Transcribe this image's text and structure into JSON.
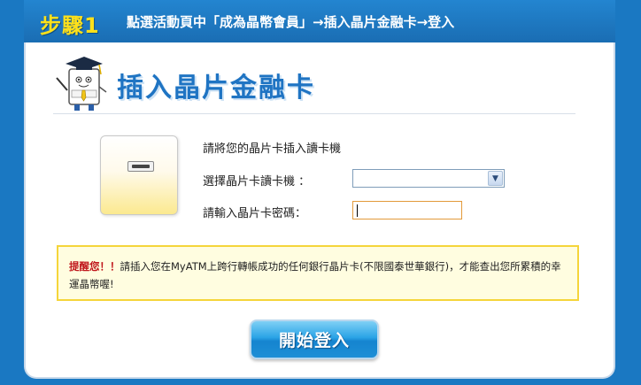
{
  "step": {
    "badge": "步驟1",
    "instruction": "點選活動頁中「成為晶幣會員」→插入晶片金融卡→登入"
  },
  "header": {
    "title": "插入晶片金融卡"
  },
  "form": {
    "prompt": "請將您的晶片卡插入讀卡機",
    "reader_label": "選擇晶片卡讀卡機 ：",
    "reader_selected": "",
    "pin_label": "請輸入晶片卡密碼："
  },
  "notice": {
    "head": "提醒您！！",
    "body": "請插入您在MyATM上跨行轉帳成功的任何銀行晶片卡(不限國泰世華銀行)，才能查出您所累積的幸運晶幣喔!"
  },
  "actions": {
    "login_label": "開始登入"
  },
  "colors": {
    "frame_blue": "#1a78c2",
    "title_blue": "#1f74c3",
    "badge_yellow": "#ffe11a",
    "notice_bg": "#fffde0",
    "notice_border": "#f5d53a",
    "alert_red": "#c0161b",
    "pin_border": "#e39a3a"
  },
  "icons": {
    "mascot": "graduate-card-mascot-icon",
    "reader": "card-reader-icon",
    "dropdown": "chevron-down-icon"
  }
}
